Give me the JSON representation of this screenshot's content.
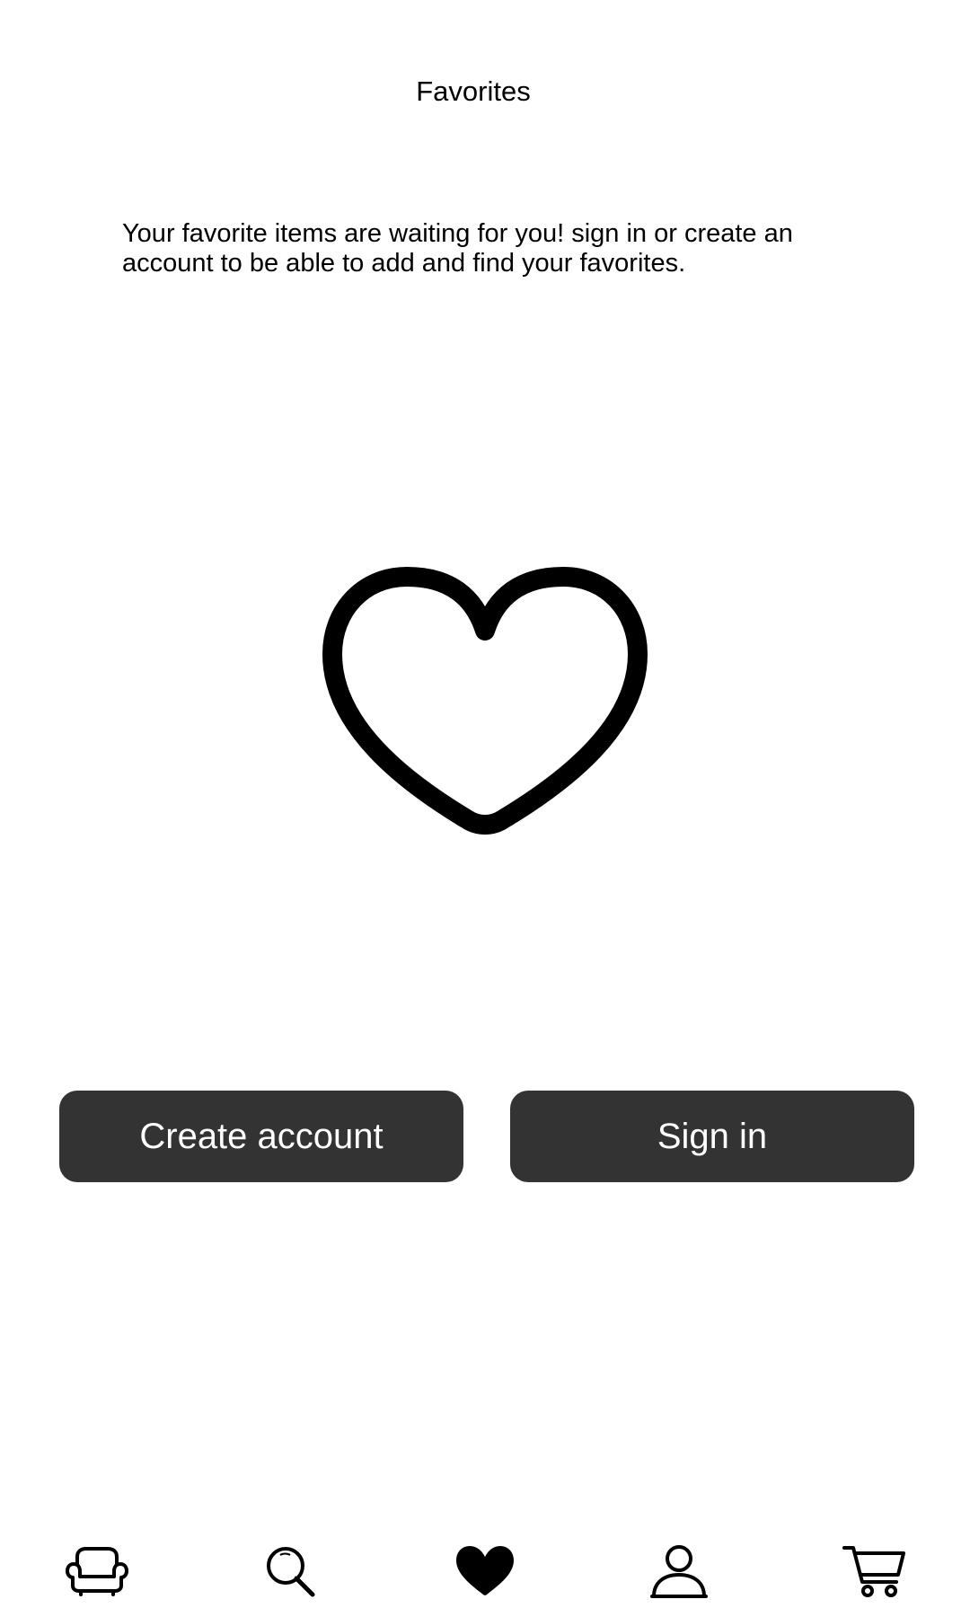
{
  "header": {
    "title": "Favorites"
  },
  "empty_state": {
    "message": "Your favorite items are waiting for you! sign in or create an account to be able to add and find your favorites.",
    "icon": "heart-outline-icon"
  },
  "actions": {
    "create_account_label": "Create account",
    "sign_in_label": "Sign in",
    "button_color": "#333333",
    "button_text_color": "#ffffff"
  },
  "bottom_nav": {
    "items": [
      {
        "id": "home",
        "icon": "sofa-icon",
        "active": false
      },
      {
        "id": "search",
        "icon": "search-icon",
        "active": false
      },
      {
        "id": "favorites",
        "icon": "heart-filled-icon",
        "active": true
      },
      {
        "id": "account",
        "icon": "person-icon",
        "active": false
      },
      {
        "id": "cart",
        "icon": "cart-icon",
        "active": false
      }
    ]
  }
}
